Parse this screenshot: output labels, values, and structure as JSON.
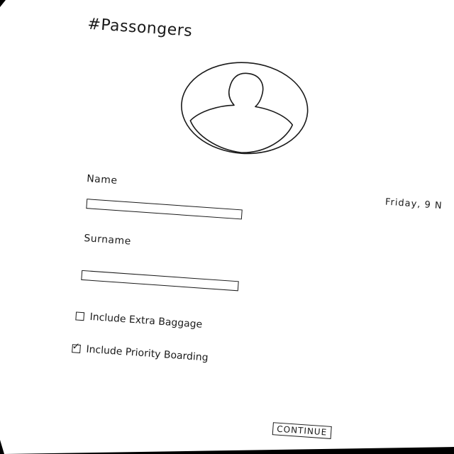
{
  "header": {
    "title": "#Passongers",
    "date": "Friday, 9 N"
  },
  "avatar": {
    "icon": "user-silhouette-icon"
  },
  "form": {
    "name_label": "Name",
    "name_value": "",
    "surname_label": "Surname",
    "surname_value": "",
    "options": [
      {
        "label": "Include Extra Baggage",
        "checked": false
      },
      {
        "label": "Include Priority Boarding",
        "checked": true
      }
    ]
  },
  "actions": {
    "continue_label": "CONTINUE"
  }
}
